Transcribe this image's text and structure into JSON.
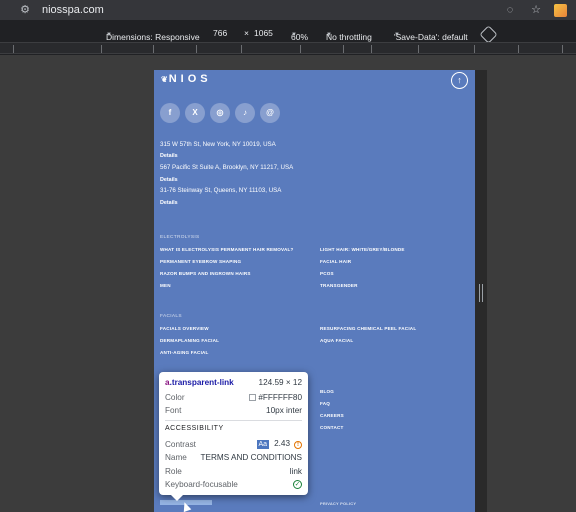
{
  "browser": {
    "url": "niosspa.com"
  },
  "device_toolbar": {
    "dimensions_label": "Dimensions: Responsive",
    "width": "766",
    "times": "×",
    "height": "1065",
    "zoom": "60%",
    "throttling": "No throttling",
    "save_data": "'Save-Data': default"
  },
  "site": {
    "logo": "NIOS",
    "logo_mark": "❦",
    "socials": [
      "f",
      "X",
      "◎",
      "♪",
      "@"
    ],
    "addresses": [
      {
        "text": "315 W 57th St, New York, NY 10019, USA",
        "details": "Details"
      },
      {
        "text": "567 Pacific St Suite A, Brooklyn, NY 11217, USA",
        "details": "Details"
      },
      {
        "text": "31-76 Steinway St, Queens, NY 11103, USA",
        "details": "Details"
      }
    ],
    "electrolysis": {
      "title": "ELECTROLYSIS",
      "left": [
        "WHAT IS ELECTROLYSIS PERMANENT HAIR REMOVAL?",
        "PERMANENT EYEBROW SHAPING",
        "RAZOR BUMPS AND INGROWN HAIRS",
        "MEN"
      ],
      "right": [
        "LIGHT HAIR: WHITE/GREY/BLONDE",
        "FACIAL HAIR",
        "PCOS",
        "TRANSGENDER"
      ]
    },
    "facials": {
      "title": "FACIALS",
      "left": [
        "FACIALS OVERVIEW",
        "DERMAPLANING FACIAL",
        "ANTI-AGING FACIAL"
      ],
      "right": [
        "RESURFACING CHEMICAL PEEL FACIAL",
        "AQUA FACIAL"
      ]
    },
    "more_links": [
      "BLOG",
      "FAQ",
      "CAREERS",
      "CONTACT"
    ],
    "privacy": "PRIVACY POLICY"
  },
  "tooltip": {
    "tag": "a",
    "cls": ".transparent-link",
    "size": "124.59 × 12",
    "color_label": "Color",
    "color_value": "#FFFFFF80",
    "font_label": "Font",
    "font_value": "10px inter",
    "accessibility_header": "ACCESSIBILITY",
    "contrast_label": "Contrast",
    "contrast_badge": "Aa",
    "contrast_value": "2.43",
    "name_label": "Name",
    "name_value": "TERMS AND CONDITIONS",
    "role_label": "Role",
    "role_value": "link",
    "keyboard_label": "Keyboard-focusable"
  },
  "colors": {
    "site_bg": "#5a7bbd",
    "devtools_bg": "#202124"
  }
}
